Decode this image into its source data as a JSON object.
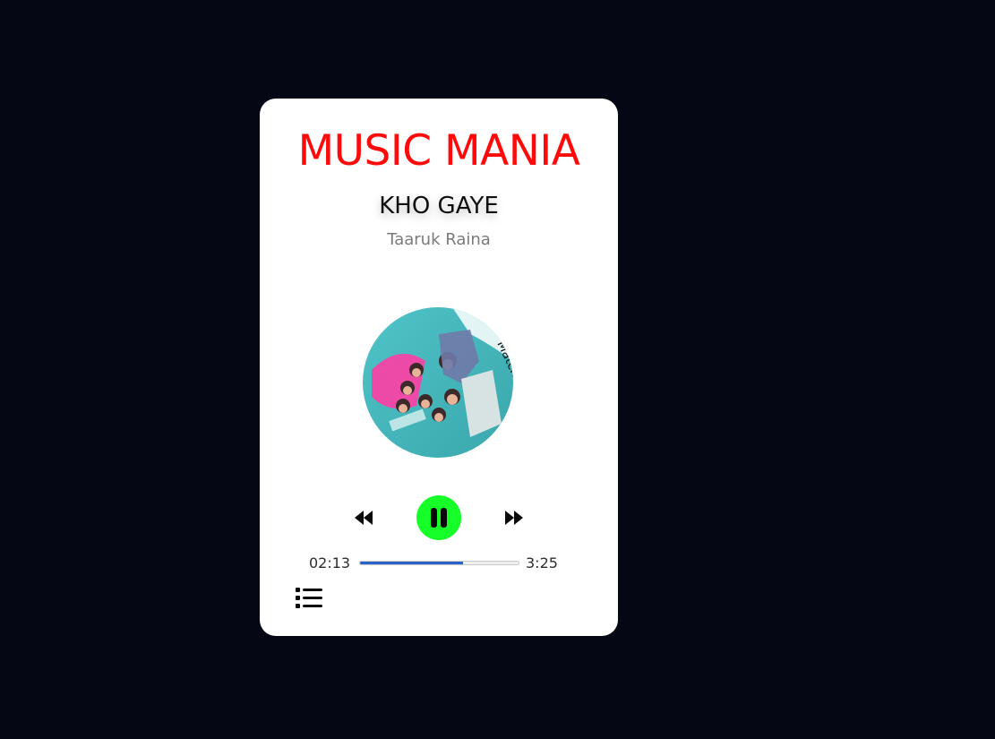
{
  "app": {
    "title": "MUSIC MANIA",
    "accent_color": "#ff0a0a",
    "background_color": "#050714",
    "card_color": "#ffffff"
  },
  "track": {
    "title": "KHO GAYE",
    "artist": "Taaruk Raina",
    "cover_icon": "album-cover"
  },
  "player": {
    "state": "playing",
    "current_time": "02:13",
    "duration": "3:25",
    "progress_fraction": 0.649,
    "play_button_color": "#17ff28",
    "progress_color": "#2a62c9"
  },
  "controls": {
    "prev_icon": "rewind-icon",
    "play_pause_icon": "pause-icon",
    "next_icon": "fast-forward-icon",
    "playlist_icon": "list-icon"
  }
}
